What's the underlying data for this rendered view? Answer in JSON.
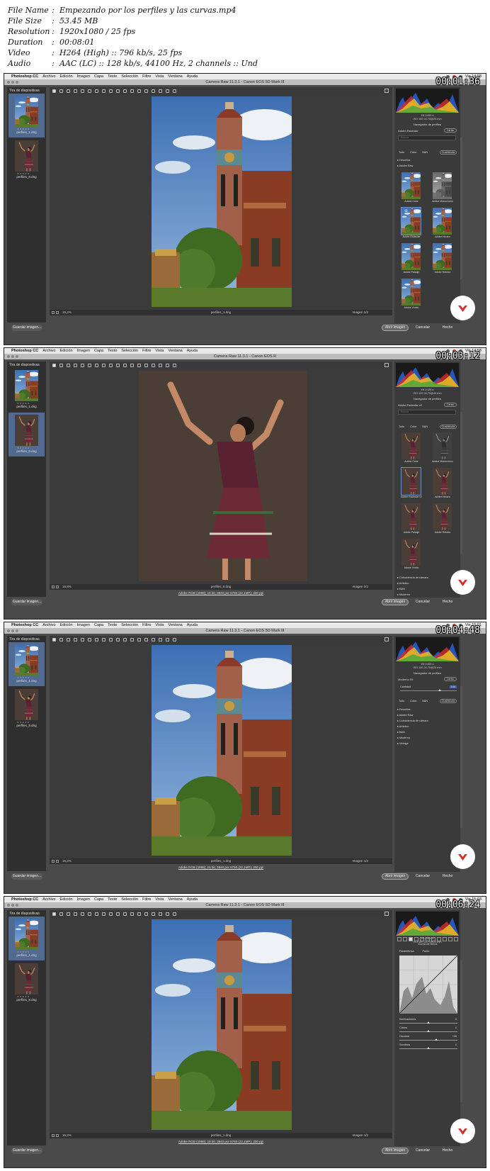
{
  "meta": {
    "rows": [
      {
        "key": "File Name",
        "value": "Empezando por los perfiles y las curvas.mp4"
      },
      {
        "key": "File Size",
        "value": "53.45 MB"
      },
      {
        "key": "Resolution",
        "value": "1920x1080 / 25 fps"
      },
      {
        "key": "Duration",
        "value": "00:08:01"
      },
      {
        "key": "Video",
        "value": "H264 (High) :: 796 kb/s, 25 fps"
      },
      {
        "key": "Audio",
        "value": "AAC (LC) :: 128 kb/s, 44100 Hz, 2 channels :: Und"
      }
    ]
  },
  "frames": [
    {
      "timestamp": "00:01:36",
      "dialog_title": "Camera Raw 11.3.1  -  Canon EOS 5D Mark III",
      "filmstrip_label": "Tira de diapositivas",
      "selected_thumb": 0,
      "photo": "tower",
      "zoom": "15,2%",
      "filename": "perfiles_1.dng",
      "image_counter": "Imagen 1/2",
      "info_link": "",
      "panel_mode": "profiles",
      "profile_name": "Adobe Estándar",
      "time": "Vie 14:58",
      "cam_iso_row": "ISO 100   24-70@25 mm",
      "cam_f_row": "f/8   1/400 s",
      "filters": [
        "Todo",
        "Color",
        "B&N"
      ],
      "filter_dropdown": "Cuadrícula",
      "groups_top": [
        "Favoritos",
        "Adobe Raw"
      ],
      "grid_labels": [
        "Adobe Color",
        "Adobe Monocromo",
        "Adobe Estándar",
        "Adobe Neutro",
        "Adobe Paisaje",
        "Adobe Retrato",
        "Adobe Vívido"
      ],
      "grid_selected": 2,
      "groups_bottom": []
    },
    {
      "timestamp": "00:03:12",
      "dialog_title": "Camera Raw 11.3.1  -  Canon EOS R",
      "filmstrip_label": "Tira de diapositivas",
      "selected_thumb": 1,
      "photo": "dancer",
      "zoom": "16,8%",
      "filename": "perfiles_8.dng",
      "image_counter": "Imagen 2/2",
      "info_link": "Adobe RGB (1998); 16 bit; 3840 por 5760 (22,1MP); 300 ppi",
      "panel_mode": "profiles",
      "profile_name": "Adobe Estándar v2",
      "time": "Vie 14:58",
      "cam_iso_row": "ISO 100   24-70@45 mm",
      "cam_f_row": "f/8   1/125 s",
      "filters": [
        "Todo",
        "Color",
        "B&N"
      ],
      "filter_dropdown": "Cuadrícula",
      "groups_top": [],
      "grid_labels": [
        "Adobe Color",
        "Adobe Monocromo",
        "Adobe Estándar v2",
        "Adobe Neutro",
        "Adobe Paisaje",
        "Adobe Retrato",
        "Adobe Vívido"
      ],
      "grid_selected": 2,
      "groups_bottom": [
        "Coincidencia de cámara",
        "Artístico",
        "B&N",
        "Moderno"
      ]
    },
    {
      "timestamp": "00:04:48",
      "dialog_title": "Camera Raw 11.3.1  -  Canon EOS 5D Mark III",
      "filmstrip_label": "Tira de diapositivas",
      "selected_thumb": 0,
      "photo": "tower",
      "zoom": "15,2%",
      "filename": "perfiles_1.dng",
      "image_counter": "Imagen 1/2",
      "info_link": "Adobe RGB (1998); 16 bit; 3840 por 5760 (22,1MP); 300 ppi",
      "panel_mode": "amount",
      "profile_name": "Moderno 09",
      "time": "Vie 15:01",
      "cam_iso_row": "ISO 100   24-70@25 mm",
      "cam_f_row": "f/8   1/400 s",
      "amount_label": "Cantidad",
      "amount_value": "100",
      "filters": [
        "Todo",
        "Color",
        "B&N"
      ],
      "filter_dropdown": "Cuadrícula",
      "groups_top": [
        "Favoritos",
        "Adobe Raw",
        "Coincidencia de cámara",
        "Artístico",
        "B&N",
        "Moderno",
        "Vintage"
      ],
      "grid_labels": [],
      "grid_selected": -1,
      "groups_bottom": []
    },
    {
      "timestamp": "00:06:24",
      "dialog_title": "Camera Raw 11.3.1  -  Canon EOS 5D Mark III",
      "filmstrip_label": "Tira de diapositivas",
      "selected_thumb": 0,
      "photo": "tower",
      "zoom": "15,2%",
      "filename": "perfiles_1.dng",
      "image_counter": "Imagen 1/2",
      "info_link": "Adobe RGB (1998); 16 bit; 3840 por 5760 (22,1MP); 300 ppi",
      "panel_mode": "curve",
      "profile_name": "",
      "time": "Vie 15:03",
      "cam_iso_row": "ISO 100   24-70@25 mm",
      "cam_f_row": "f/8   1/400 s",
      "curve_title": "Curva de tonos",
      "curve_tabs": [
        "Paramétrica",
        "Punto"
      ],
      "sliders": [
        {
          "label": "Iluminaciones",
          "value": "0",
          "level": 0.5
        },
        {
          "label": "Claros",
          "value": "0",
          "level": 0.5
        },
        {
          "label": "Oscuros",
          "value": "+26",
          "level": 0.63
        },
        {
          "label": "Sombras",
          "value": "0",
          "level": 0.5
        }
      ],
      "filters": [],
      "filter_dropdown": "",
      "groups_top": [],
      "grid_labels": [],
      "grid_selected": -1,
      "groups_bottom": []
    }
  ],
  "menubar": {
    "app": "Photoshop CC",
    "items": [
      "Archivo",
      "Edición",
      "Imagen",
      "Capa",
      "Texto",
      "Selección",
      "Filtro",
      "Vista",
      "Ventana",
      "Ayuda"
    ]
  },
  "common": {
    "nav_label": "Navegador de perfiles",
    "close_label": "Cerrar",
    "search_placeholder": "Buscar",
    "btn_save": "Guardar imagen...",
    "btn_open": "Abrir imagen",
    "btn_cancel": "Cancelar",
    "btn_done": "Hecho",
    "thumb_names": [
      "perfiles_1.dng",
      "perfiles_8.dng"
    ]
  },
  "colors": {
    "app_bg": "#4a4a4a",
    "selection_blue": "#506a90",
    "accent_red": "#c0392b"
  }
}
